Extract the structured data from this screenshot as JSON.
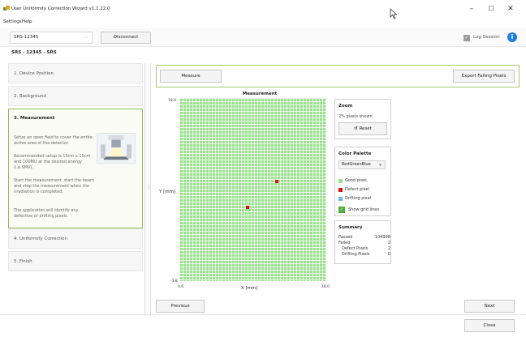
{
  "window": {
    "title": "User Uniformity Correction Wizard v1.1.22.0",
    "minimize": "–",
    "maximize": "☐",
    "close": "✕"
  },
  "menu": {
    "settings": "Settings",
    "help": "Help"
  },
  "toolbar": {
    "device_value": "SRS-12345",
    "disconnect_label": "Disconnect",
    "log_session_label": "Log Session",
    "log_session_checked": true
  },
  "device_label": "SRS - 12345 - SRS",
  "steps": [
    {
      "label": "1. Device Position"
    },
    {
      "label": "2. Background"
    },
    {
      "label": "3. Measurement"
    },
    {
      "label": "4. Uniformity Correction"
    },
    {
      "label": "5. Finish"
    }
  ],
  "active_step": {
    "title": "3. Measurement",
    "p1": "Setup an open field to cover the entire active area of the detector.",
    "p2": "Recommended setup is 15cm x 15cm and 100MU at the desired energy (i.e.6MV).",
    "p3": "Start the measurement, start the beam and stop the measurement when the irradiation is completed.",
    "p4": "The application will identify any defective or drifting pixels."
  },
  "actions": {
    "measure": "Measure",
    "export": "Export Failing Pixels"
  },
  "chart_data": {
    "type": "heatmap",
    "title": "Measurement",
    "xlabel": "X [mm]",
    "ylabel": "Y [mm]",
    "xlim": [
      0.6,
      18.0
    ],
    "ylim": [
      -3.8,
      18.6
    ],
    "x_tick_labels": [
      "0.6",
      "18.0"
    ],
    "y_tick_labels": [
      "18.6",
      "-3.8"
    ],
    "grid": true,
    "colors": {
      "good": "#9be190",
      "defect": "#e01010",
      "drifting": "#6bb6ef"
    },
    "defect_points": [
      {
        "x": 8.7,
        "y": 5.2
      },
      {
        "x": 12.1,
        "y": 8.4
      }
    ]
  },
  "zoom": {
    "title": "Zoom",
    "shown_text": "2% pixels shown",
    "reset_label": "Reset",
    "reset_icon": "undo-icon"
  },
  "palette": {
    "title": "Color Palette",
    "selected": "RedGreenBlue",
    "legend": [
      {
        "label": "Good pixel",
        "color": "#9be190"
      },
      {
        "label": "Defect pixel",
        "color": "#e01010"
      },
      {
        "label": "Drifting pixel",
        "color": "#6bb6ef"
      }
    ],
    "show_grid_label": "Show grid lines",
    "show_grid_checked": true
  },
  "summary": {
    "title": "Summary",
    "passed_label": "Passed",
    "passed_value": "104998",
    "failed_label": "Failed",
    "failed_value": "2",
    "defect_label": "Defect Pixels",
    "defect_value": "2",
    "drifting_label": "Drifting Pixels",
    "drifting_value": "0"
  },
  "nav": {
    "previous": "Previous",
    "next": "Next",
    "close": "Close"
  }
}
